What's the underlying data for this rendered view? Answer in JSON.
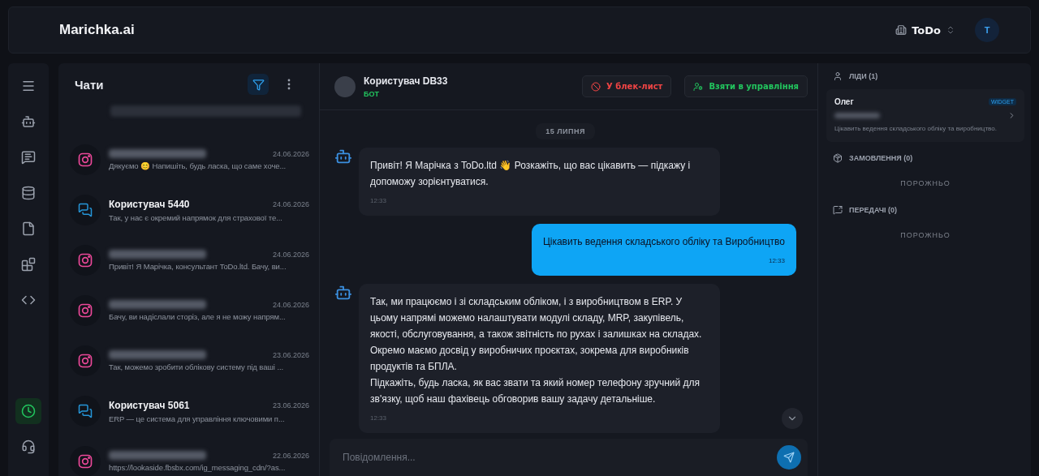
{
  "app": {
    "title": "Marichka.ai",
    "company": "ToDo",
    "avatar": "T"
  },
  "rail": [
    {
      "kind": "menu",
      "selected": false
    },
    {
      "kind": "bot",
      "selected": false
    },
    {
      "kind": "chat",
      "selected": false
    },
    {
      "kind": "database",
      "selected": false
    },
    {
      "kind": "file",
      "selected": false
    },
    {
      "kind": "blocks",
      "selected": false
    },
    {
      "kind": "code",
      "selected": false
    }
  ],
  "rail_bottom": [
    {
      "kind": "clock",
      "selected": true
    },
    {
      "kind": "headset",
      "selected": false
    }
  ],
  "chats": {
    "title": "Чати",
    "filter_active": true,
    "items": [
      {
        "kind": "instagram",
        "date": "24.06.2026",
        "preview": "Дякуємо 😊 Напишіть, будь ласка, що саме хоче...",
        "selected": false
      },
      {
        "kind": "widget",
        "name": "Користувач 5440",
        "date": "24.06.2026",
        "preview": "Так, у нас є окремий напрямок для страхової те...",
        "selected": false
      },
      {
        "kind": "instagram",
        "date": "24.06.2026",
        "preview": "Привіт! Я Марічка, консультант ToDo.ltd. Бачу, ви...",
        "selected": false
      },
      {
        "kind": "instagram",
        "date": "24.06.2026",
        "preview": "Бачу, ви надіслали сторіз, але я не можу напрям...",
        "selected": false
      },
      {
        "kind": "instagram",
        "date": "23.06.2026",
        "preview": "Так, можемо зробити облікову систему під ваші ...",
        "selected": false
      },
      {
        "kind": "widget",
        "name": "Користувач 5061",
        "date": "23.06.2026",
        "preview": "ERP — це система для управління ключовими п...",
        "selected": false
      },
      {
        "kind": "instagram",
        "date": "22.06.2026",
        "preview": "https://lookaside.fbsbx.com/ig_messaging_cdn/?as...",
        "selected": false
      }
    ]
  },
  "conversation": {
    "user": "Користувач DB33",
    "mode": "БОТ",
    "blacklist_button": "У блек-лист",
    "takeover_button": "Взяти в управління",
    "date": "15 ЛИПНЯ",
    "messages": [
      {
        "kind": "bot",
        "paragraphs": [
          "Привіт! Я Марічка з ToDo.ltd 👋 Розкажіть, що вас цікавить — підкажу і допоможу зорієнтуватися."
        ],
        "time": "12:33"
      },
      {
        "kind": "user",
        "paragraphs": [
          "Цікавить ведення складського обліку та Виробництво"
        ],
        "time": "12:33"
      },
      {
        "kind": "bot",
        "paragraphs": [
          "Так, ми працюємо і зі складським обліком, і з виробництвом в ERP. У цьому напрямі можемо налаштувати модулі складу, MRP, закупівель, якості, обслуговування, а також звітність по рухах і залишках на складах.",
          "Окремо маємо досвід у виробничих проєктах, зокрема для виробників продуктів та БПЛА.",
          "Підкажіть, будь ласка, як вас звати та який номер телефону зручний для зв'язку, щоб наш фахівець обговорив вашу задачу детальніше."
        ],
        "time": "12:33"
      }
    ],
    "composer": {
      "placeholder": "Повідомлення..."
    }
  },
  "side": {
    "sections": [
      {
        "kind": "leads",
        "title": "ЛІДИ (1)",
        "cards": [
          {
            "name": "Олег",
            "source": "WIDGET",
            "note": "Цікавить ведення складського обліку та виробництво."
          }
        ]
      },
      {
        "kind": "orders",
        "title": "ЗАМОВЛЕННЯ (0)",
        "empty": "ПОРОЖНЬО"
      },
      {
        "kind": "transfers",
        "title": "ПЕРЕДАЧІ (0)",
        "empty": "ПОРОЖНЬО"
      }
    ]
  }
}
